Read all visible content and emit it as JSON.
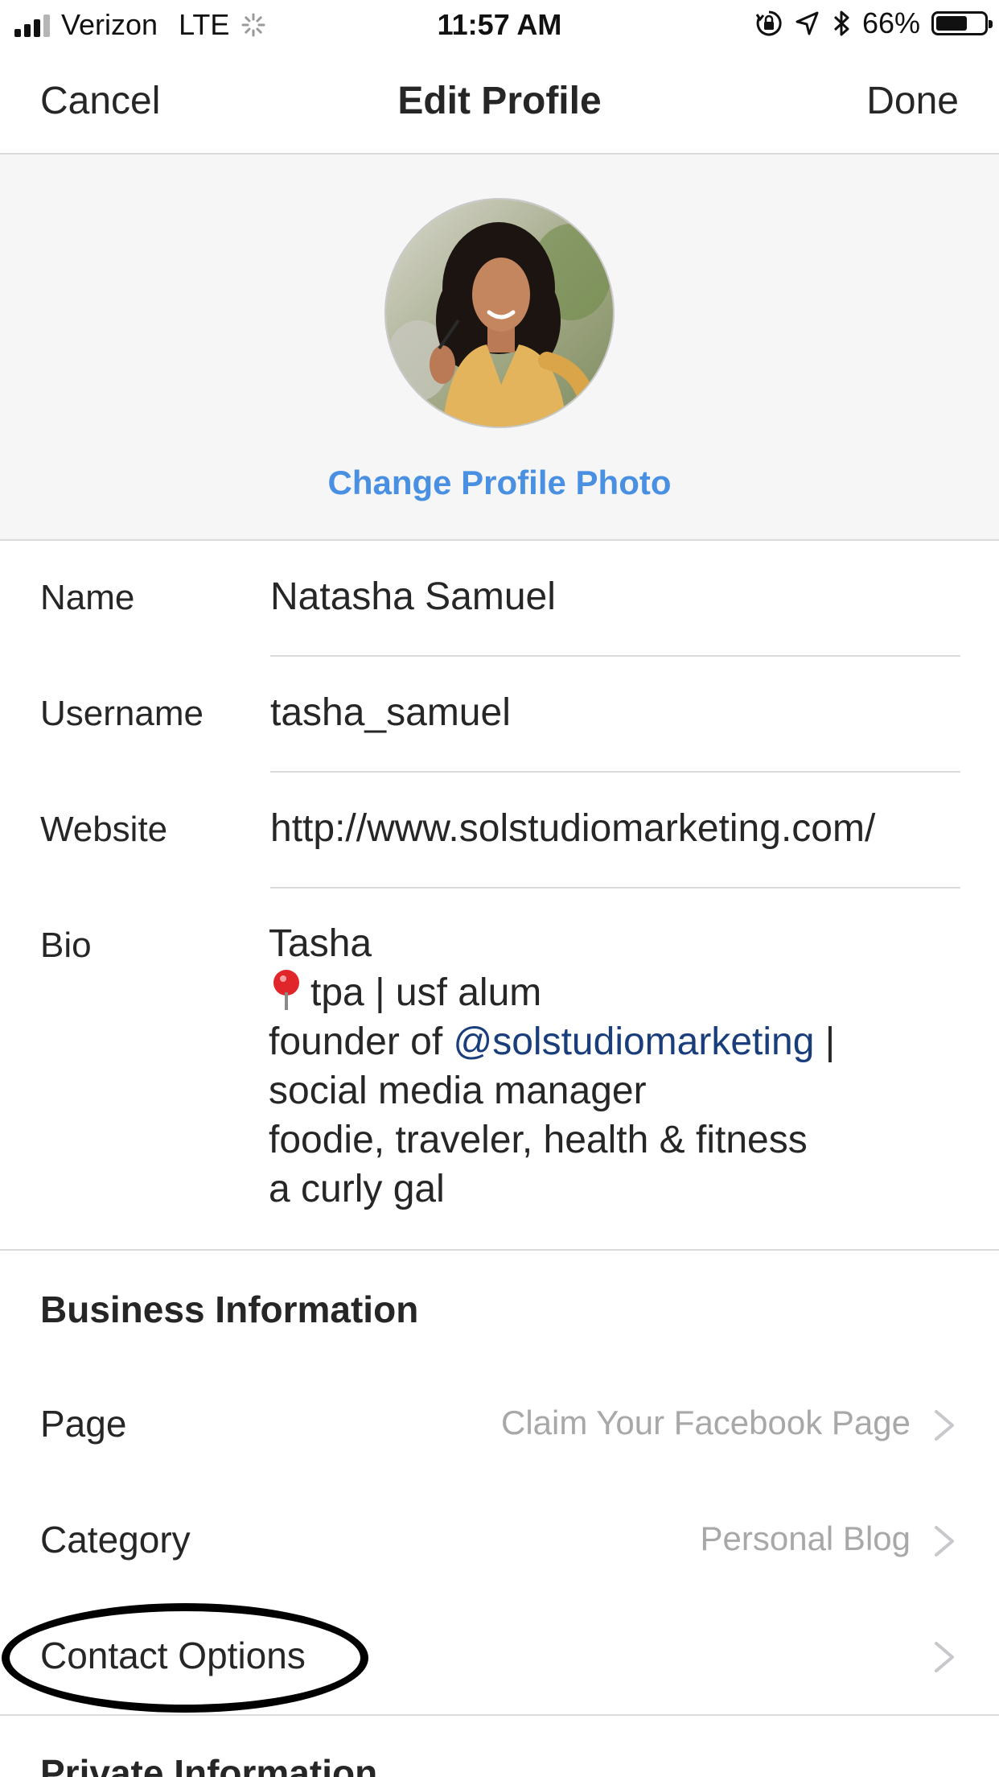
{
  "status_bar": {
    "carrier": "Verizon",
    "network": "LTE",
    "time": "11:57 AM",
    "battery_percent": "66%",
    "battery_level": 0.66,
    "icons": [
      "signal-icon",
      "loading-spinner-icon",
      "orientation-lock-icon",
      "location-arrow-icon",
      "bluetooth-icon",
      "battery-icon"
    ]
  },
  "nav": {
    "cancel_label": "Cancel",
    "title": "Edit Profile",
    "done_label": "Done"
  },
  "profile_photo": {
    "change_label": "Change Profile Photo",
    "accent_color": "#4a90e2"
  },
  "fields": {
    "name": {
      "label": "Name",
      "value": "Natasha Samuel"
    },
    "username": {
      "label": "Username",
      "value": "tasha_samuel"
    },
    "website": {
      "label": "Website",
      "value": "http://www.solstudiomarketing.com/"
    },
    "bio": {
      "label": "Bio",
      "line1": "Tasha",
      "line2": "tpa | usf alum",
      "line3_prefix": "founder of ",
      "line3_mention": "@solstudiomarketing",
      "line3_suffix": " |",
      "line4": "social media manager",
      "line5": "foodie, traveler, health & fitness",
      "line6": "a curly gal",
      "pin_emoji": "round-pushpin-icon",
      "mention_color": "#1a3d7c"
    }
  },
  "business": {
    "heading": "Business Information",
    "rows": [
      {
        "label": "Page",
        "value": "Claim Your Facebook Page"
      },
      {
        "label": "Category",
        "value": "Personal Blog"
      },
      {
        "label": "Contact Options",
        "value": ""
      }
    ]
  },
  "private": {
    "heading": "Private Information"
  }
}
